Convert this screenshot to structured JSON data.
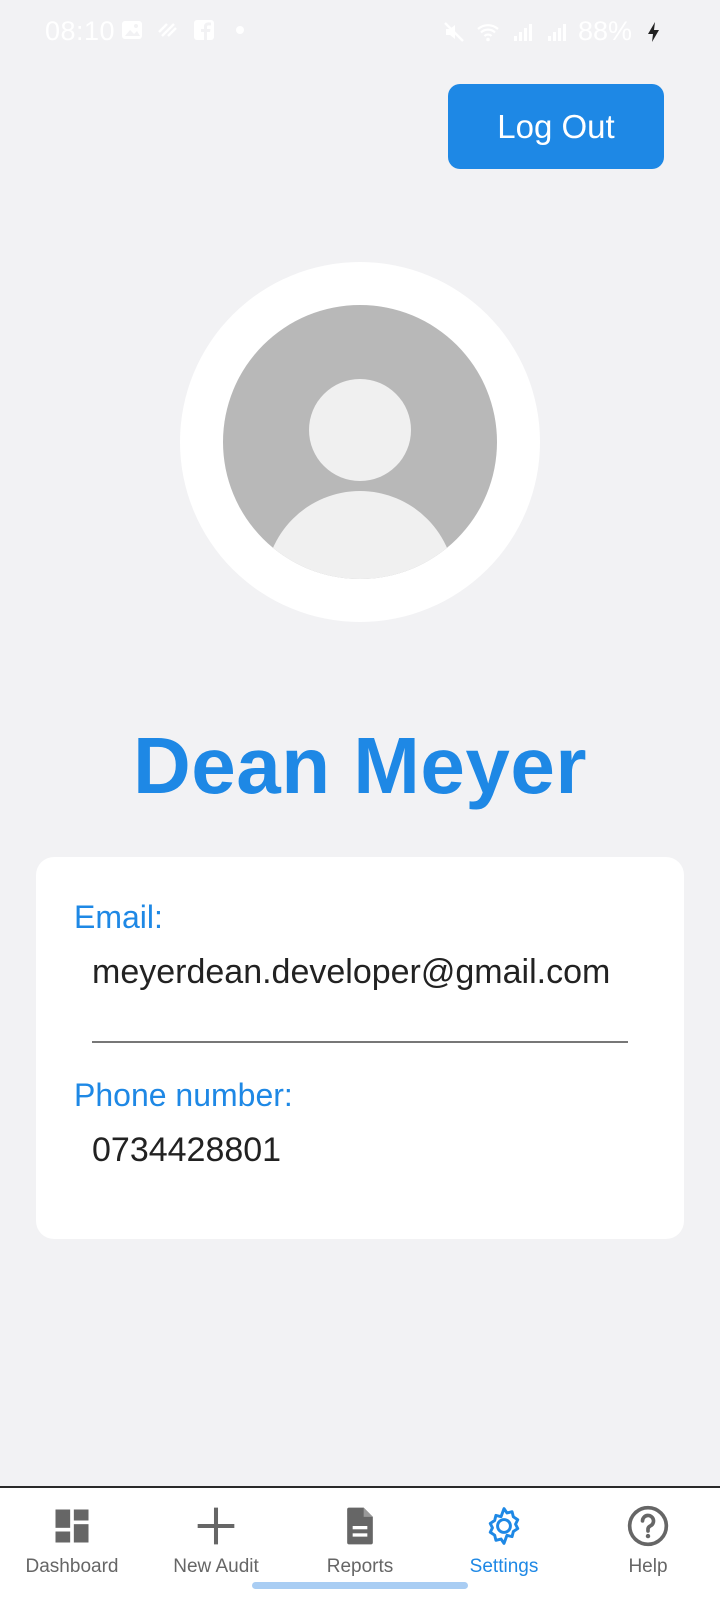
{
  "status_bar": {
    "time": "08:10",
    "battery": "88%",
    "icons_left": [
      "gallery-icon",
      "cast-icon",
      "facebook-icon",
      "dot-icon"
    ],
    "icons_right": [
      "mute-icon",
      "wifi-icon",
      "signal-lte1-icon",
      "signal-lte2-icon",
      "charging-icon"
    ]
  },
  "header": {
    "logout_label": "Log Out"
  },
  "profile": {
    "name": "Dean Meyer",
    "email_label": "Email:",
    "email": "meyerdean.developer@gmail.com",
    "phone_label": "Phone number:",
    "phone": "0734428801"
  },
  "nav": {
    "items": [
      {
        "label": "Dashboard",
        "icon": "dashboard-icon"
      },
      {
        "label": "New Audit",
        "icon": "plus-icon"
      },
      {
        "label": "Reports",
        "icon": "document-icon"
      },
      {
        "label": "Settings",
        "icon": "gear-icon",
        "active": true
      },
      {
        "label": "Help",
        "icon": "help-icon"
      }
    ]
  },
  "colors": {
    "accent": "#1e88e5",
    "background": "#f2f2f4",
    "inactive": "#666666"
  }
}
